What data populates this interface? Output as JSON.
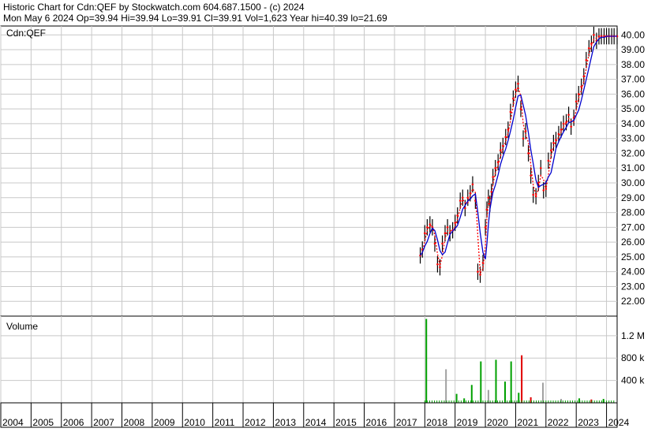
{
  "header": {
    "line1": "Historic Chart for Cdn:QEF by Stockwatch.com 604.687.1500 - (c) 2024",
    "line2": "Mon May  6 2024  Op=39.94  Hi=39.94  Lo=39.91  Cl=39.91  Vol=1,623  Year hi=40.39  lo=21.69"
  },
  "price_panel": {
    "label": "Cdn:QEF"
  },
  "volume_panel": {
    "label": "Volume"
  },
  "colors": {
    "grid": "#c8c8c8",
    "price_bar": "#000000",
    "ma_short": "#ff0000",
    "ma_long": "#0000cc",
    "vol_up": "#00a000",
    "vol_down": "#e00000",
    "vol_neutral": "#a0a0a0"
  },
  "chart_data": [
    {
      "type": "line",
      "title": "Cdn:QEF",
      "x_range": [
        2004,
        2024.35
      ],
      "ylim": [
        21,
        40.6
      ],
      "y_ticks": [
        22.0,
        23.0,
        24.0,
        25.0,
        26.0,
        27.0,
        28.0,
        29.0,
        30.0,
        31.0,
        32.0,
        33.0,
        34.0,
        35.0,
        36.0,
        37.0,
        38.0,
        39.0,
        40.0
      ],
      "y_tick_labels": [
        "22.00",
        "23.00",
        "24.00",
        "25.00",
        "26.00",
        "27.00",
        "28.00",
        "29.00",
        "30.00",
        "31.00",
        "32.00",
        "33.00",
        "34.00",
        "35.00",
        "36.00",
        "37.00",
        "38.00",
        "39.00",
        "40.00"
      ],
      "x_tick_labels": [
        "2004",
        "2005",
        "2006",
        "2007",
        "2008",
        "2009",
        "2010",
        "2011",
        "2012",
        "2013",
        "2014",
        "2015",
        "2016",
        "2017",
        "2018",
        "2019",
        "2020",
        "2021",
        "2022",
        "2023",
        "2024"
      ],
      "grid": true,
      "series": [
        {
          "kind": "price",
          "x": [
            2017.85,
            2017.92,
            2018.0,
            2018.08,
            2018.17,
            2018.25,
            2018.33,
            2018.42,
            2018.5,
            2018.58,
            2018.67,
            2018.75,
            2018.83,
            2018.92,
            2019.0,
            2019.08,
            2019.17,
            2019.25,
            2019.33,
            2019.42,
            2019.5,
            2019.58,
            2019.67,
            2019.75,
            2019.83,
            2019.92,
            2020.0,
            2020.05,
            2020.1,
            2020.15,
            2020.2,
            2020.25,
            2020.33,
            2020.42,
            2020.5,
            2020.58,
            2020.67,
            2020.75,
            2020.83,
            2020.92,
            2021.0,
            2021.08,
            2021.17,
            2021.25,
            2021.33,
            2021.42,
            2021.5,
            2021.58,
            2021.67,
            2021.75,
            2021.83,
            2021.92,
            2022.0,
            2022.08,
            2022.17,
            2022.25,
            2022.33,
            2022.42,
            2022.5,
            2022.58,
            2022.67,
            2022.75,
            2022.83,
            2022.92,
            2023.0,
            2023.08,
            2023.17,
            2023.25,
            2023.33,
            2023.42,
            2023.5,
            2023.58,
            2023.67,
            2023.75,
            2023.83,
            2023.92,
            2024.0,
            2024.08,
            2024.17,
            2024.25,
            2024.35
          ],
          "y": [
            25.1,
            25.5,
            26.6,
            27.0,
            27.2,
            27.0,
            25.9,
            24.5,
            24.3,
            25.9,
            26.6,
            27.0,
            26.6,
            26.8,
            27.3,
            27.8,
            28.8,
            29.0,
            28.3,
            29.0,
            29.3,
            29.9,
            28.8,
            24.0,
            23.8,
            24.6,
            27.0,
            28.2,
            29.0,
            28.6,
            29.4,
            30.4,
            31.0,
            31.4,
            32.2,
            32.5,
            33.1,
            33.6,
            34.8,
            35.7,
            36.3,
            36.7,
            35.0,
            33.0,
            33.5,
            32.0,
            30.5,
            29.2,
            29.1,
            30.0,
            31.0,
            29.5,
            29.6,
            31.5,
            32.2,
            32.7,
            32.9,
            33.3,
            33.6,
            34.0,
            34.1,
            34.6,
            33.8,
            34.4,
            35.5,
            36.0,
            36.5,
            37.2,
            38.3,
            39.1,
            39.4,
            40.0,
            39.6,
            39.9,
            39.91,
            39.91,
            39.91,
            39.91,
            39.91,
            39.91,
            39.91
          ]
        },
        {
          "kind": "moving-average",
          "name": "",
          "color": "ma_short"
        },
        {
          "kind": "moving-average",
          "name": "",
          "color": "ma_long"
        }
      ]
    },
    {
      "type": "bar",
      "title": "Volume",
      "y_ticks": [
        400000,
        800000,
        1200000
      ],
      "y_tick_labels": [
        "400 k",
        "800 k",
        "1.2 M"
      ],
      "ylim": [
        0,
        1550000
      ],
      "bars": [
        {
          "x": 2018.05,
          "v": 1500000,
          "c": "vol_up"
        },
        {
          "x": 2018.7,
          "v": 600000,
          "c": "vol_neutral"
        },
        {
          "x": 2019.05,
          "v": 160000,
          "c": "vol_up"
        },
        {
          "x": 2019.3,
          "v": 80000,
          "c": "vol_up"
        },
        {
          "x": 2019.55,
          "v": 320000,
          "c": "vol_up"
        },
        {
          "x": 2019.85,
          "v": 740000,
          "c": "vol_up"
        },
        {
          "x": 2020.1,
          "v": 230000,
          "c": "vol_neutral"
        },
        {
          "x": 2020.35,
          "v": 770000,
          "c": "vol_up"
        },
        {
          "x": 2020.65,
          "v": 380000,
          "c": "vol_up"
        },
        {
          "x": 2020.85,
          "v": 740000,
          "c": "vol_up"
        },
        {
          "x": 2021.1,
          "v": 180000,
          "c": "vol_up"
        },
        {
          "x": 2021.2,
          "v": 850000,
          "c": "vol_down"
        },
        {
          "x": 2021.5,
          "v": 100000,
          "c": "vol_down"
        },
        {
          "x": 2021.9,
          "v": 360000,
          "c": "vol_neutral"
        },
        {
          "x": 2022.5,
          "v": 70000,
          "c": "vol_neutral"
        },
        {
          "x": 2023.1,
          "v": 80000,
          "c": "vol_up"
        },
        {
          "x": 2023.5,
          "v": 60000,
          "c": "vol_down"
        },
        {
          "x": 2023.9,
          "v": 70000,
          "c": "vol_up"
        }
      ]
    }
  ]
}
